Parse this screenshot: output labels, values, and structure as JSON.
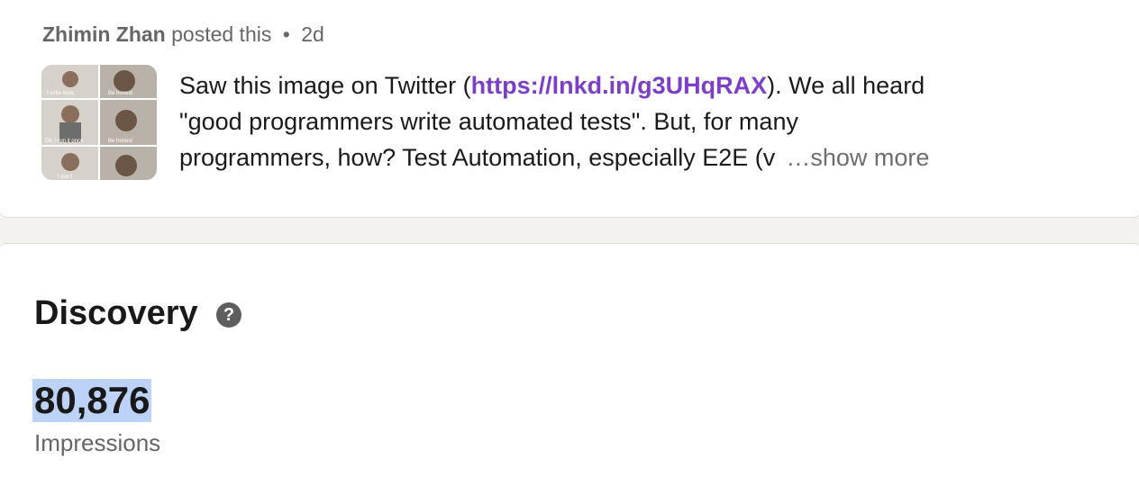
{
  "post": {
    "author": "Zhimin Zhan",
    "action": "posted this",
    "separator": "•",
    "age": "2d",
    "thumbnail": {
      "captions": [
        "I write tests",
        "Be honest",
        "Ok, I run it once",
        "Be honest",
        "I don't"
      ]
    },
    "text": {
      "line1_before": "Saw this image on Twitter (",
      "link": "https://lnkd.in/g3UHqRAX",
      "line1_after": "). We all heard",
      "line2": "\"good programmers write automated tests\". But, for many",
      "line3": "programmers, how? Test Automation, especially E2E (v",
      "show_more": "…show more"
    }
  },
  "discovery": {
    "title": "Discovery",
    "help_icon": "question-circle-icon",
    "impressions_value": "80,876",
    "impressions_label": "Impressions"
  },
  "colors": {
    "link": "#7b3fc8",
    "highlight": "#bcd3f7",
    "page_gap": "#f3f2ef"
  }
}
